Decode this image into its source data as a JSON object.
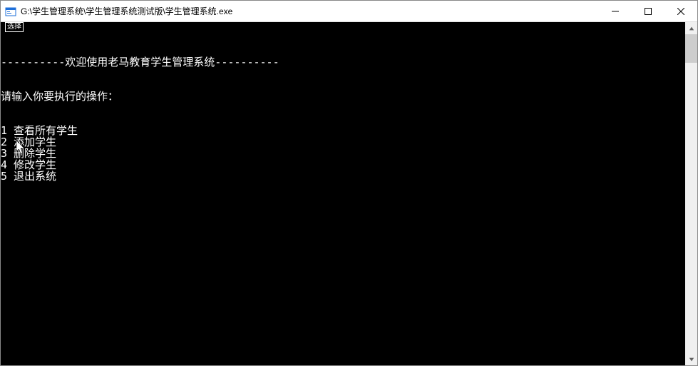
{
  "window": {
    "title": "G:\\学生管理系统\\学生管理系统测试版\\学生管理系统.exe"
  },
  "console": {
    "banner": "----------欢迎使用老马教育学生管理系统----------",
    "prompt": "请输入你要执行的操作：",
    "menu": [
      {
        "num": "1",
        "label": "查看所有学生"
      },
      {
        "num": "2",
        "label": "添加学生"
      },
      {
        "num": "3",
        "label": "删除学生"
      },
      {
        "num": "4",
        "label": "修改学生"
      },
      {
        "num": "5",
        "label": "退出系统"
      }
    ]
  }
}
